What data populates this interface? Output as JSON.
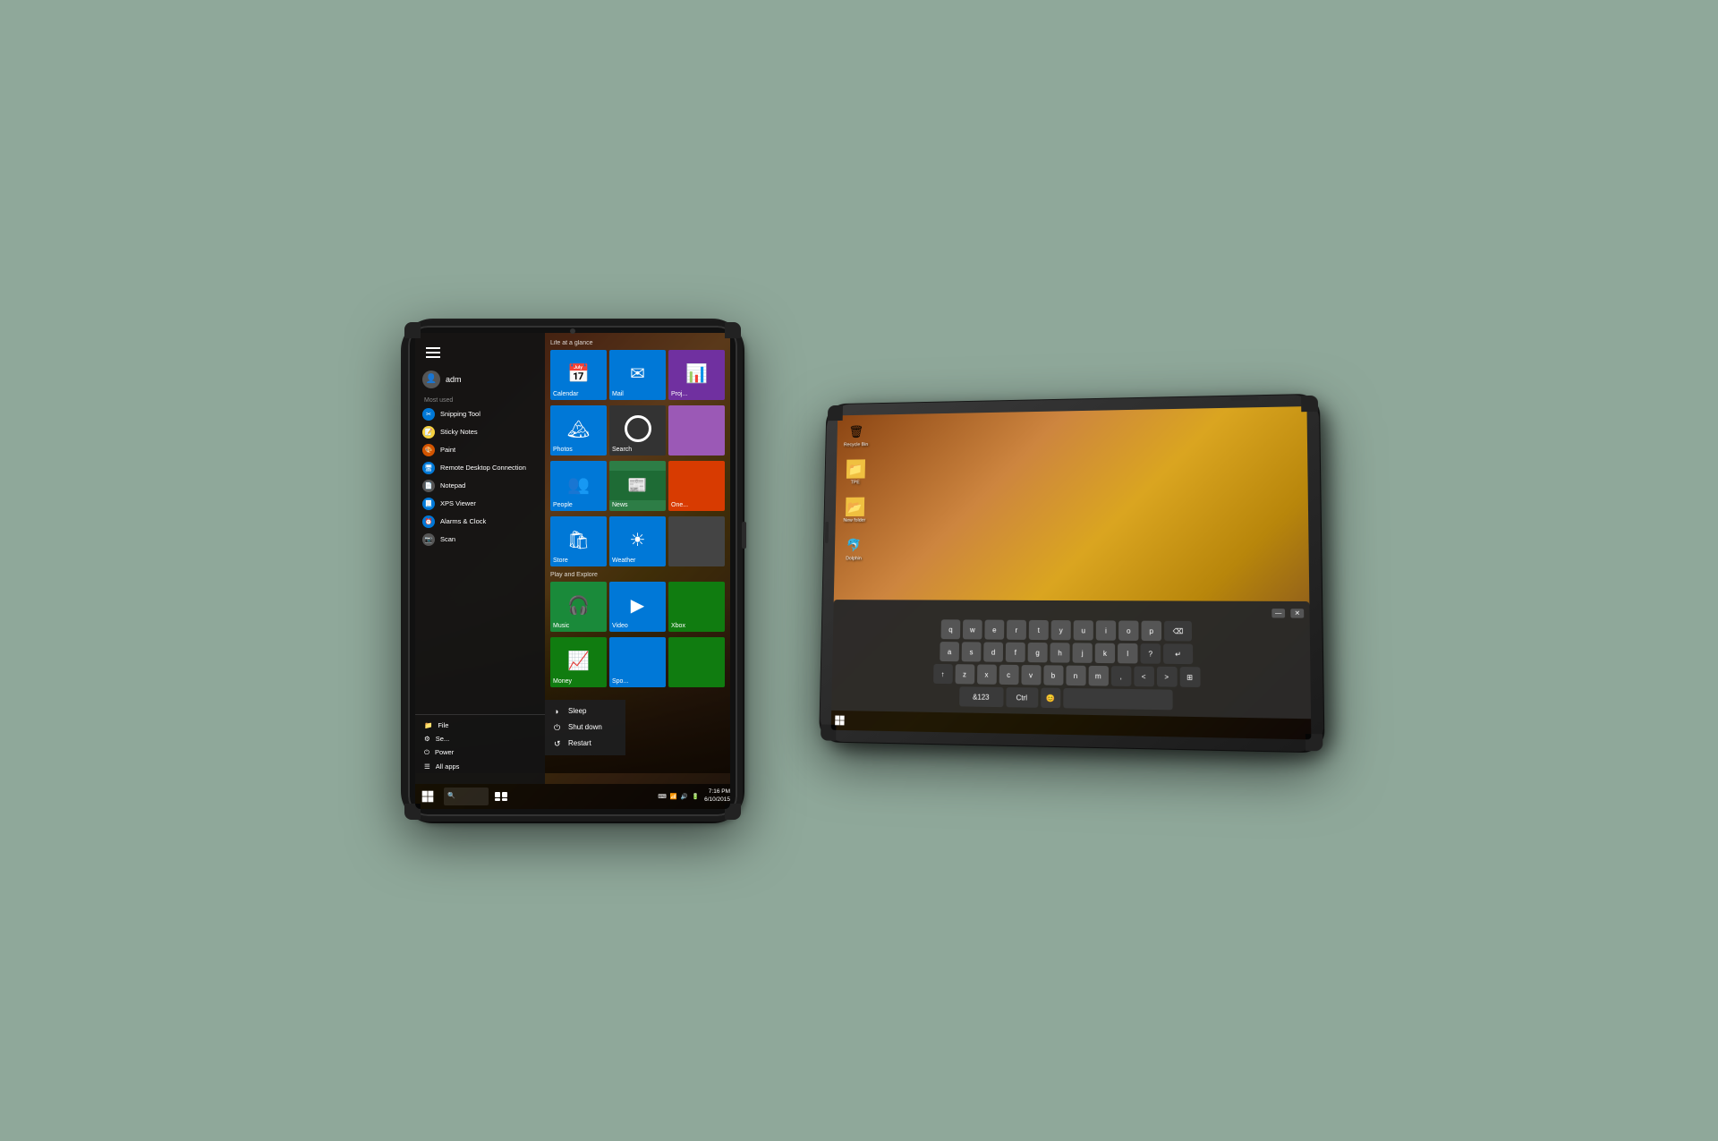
{
  "background_color": "#8fa89a",
  "left_tablet": {
    "type": "portrait",
    "os": "Windows 10",
    "start_menu": {
      "user": "adm",
      "most_used_label": "Most used",
      "apps": [
        {
          "name": "Snipping Tool",
          "icon_color": "#0078d7"
        },
        {
          "name": "Sticky Notes",
          "icon_color": "#f4d03f"
        },
        {
          "name": "Paint",
          "icon_color": "#d35400"
        },
        {
          "name": "Remote Desktop Connection",
          "icon_color": "#0078d7"
        },
        {
          "name": "Notepad",
          "icon_color": "#555"
        },
        {
          "name": "XPS Viewer",
          "icon_color": "#0078d7"
        },
        {
          "name": "Alarms & Clock",
          "icon_color": "#0078d7"
        },
        {
          "name": "Scan",
          "icon_color": "#555"
        }
      ],
      "bottom_items": [
        {
          "name": "File Explorer",
          "icon": "📁"
        },
        {
          "name": "Settings",
          "icon": "⚙"
        },
        {
          "name": "Power",
          "icon": "⏻"
        },
        {
          "name": "All apps",
          "icon": "☰"
        }
      ],
      "power_options": [
        "Sleep",
        "Shut down",
        "Restart"
      ],
      "tiles_section1_label": "Life at a glance",
      "tiles_row1": [
        {
          "label": "Calendar",
          "color": "#0078d7",
          "icon": "📅"
        },
        {
          "label": "Mail",
          "color": "#0078d7",
          "icon": "✉"
        },
        {
          "label": "Proj...",
          "color": "#7030a0",
          "icon": "📊"
        }
      ],
      "tiles_row2": [
        {
          "label": "Photos",
          "color": "#0078d7",
          "icon": "🏔"
        },
        {
          "label": "Search",
          "color": "#333",
          "icon": "○"
        },
        {
          "label": "",
          "color": "#555",
          "icon": ""
        }
      ],
      "tiles_row3": [
        {
          "label": "People",
          "color": "#0078d7",
          "icon": "👥"
        },
        {
          "label": "News",
          "color": "#2d7d46",
          "icon": "📰"
        },
        {
          "label": "One...",
          "color": "#d83b01",
          "icon": ""
        }
      ],
      "tiles_row4": [
        {
          "label": "Store",
          "color": "#0078d7",
          "icon": "🛍"
        },
        {
          "label": "Weather",
          "color": "#0078d7",
          "icon": "☀"
        },
        {
          "label": "",
          "color": "#555",
          "icon": ""
        }
      ],
      "tiles_section2_label": "Play and Explore",
      "tiles_row5": [
        {
          "label": "Music",
          "color": "#1a8a3a",
          "icon": "🎧"
        },
        {
          "label": "Video",
          "color": "#0078d7",
          "icon": "▶"
        },
        {
          "label": "Xbox",
          "color": "#107c10",
          "icon": ""
        }
      ],
      "tiles_row6": [
        {
          "label": "Money",
          "color": "#107c10",
          "icon": "📈"
        },
        {
          "label": "Spo...",
          "color": "#0078d7",
          "icon": ""
        },
        {
          "label": "",
          "color": "#555",
          "icon": ""
        }
      ]
    },
    "taskbar": {
      "time": "7:16 PM",
      "date": "6/10/2015"
    }
  },
  "right_tablet": {
    "type": "landscape",
    "os": "Windows 10",
    "desktop_icons": [
      {
        "label": "Recycle Bin",
        "icon": "🗑"
      },
      {
        "label": "TPE",
        "icon": "📁"
      },
      {
        "label": "New folder",
        "icon": "📂"
      },
      {
        "label": "Dolphin",
        "icon": "🐬"
      }
    ],
    "keyboard": {
      "rows": [
        [
          "q",
          "w",
          "e",
          "r",
          "t",
          "y",
          "u",
          "i",
          "o",
          "p",
          "⌫"
        ],
        [
          "a",
          "s",
          "d",
          "f",
          "g",
          "h",
          "j",
          "k",
          "l",
          "?",
          "↵"
        ],
        [
          "↑",
          "z",
          "x",
          "c",
          "v",
          "b",
          "n",
          "m",
          ",",
          "<",
          ">",
          "⊞"
        ],
        [
          "&123",
          "Ctrl",
          "😊",
          "",
          "",
          "",
          "",
          "",
          "",
          "",
          "",
          ""
        ]
      ]
    }
  }
}
